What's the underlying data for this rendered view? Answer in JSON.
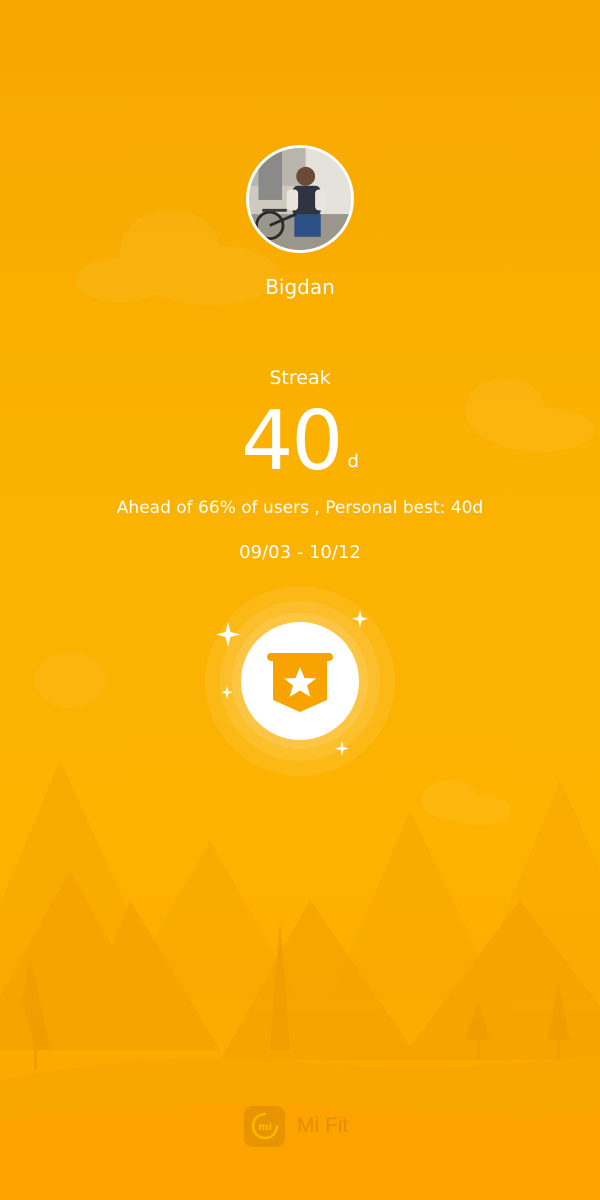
{
  "profile": {
    "username": "Bigdan"
  },
  "streak": {
    "label": "Streak",
    "value": "40",
    "unit": "d",
    "summary": "Ahead of 66% of users , Personal best: 40d",
    "date_range": "09/03 - 10/12"
  },
  "footer": {
    "brand_name": "Mi Fit",
    "logo_text": "mi"
  },
  "icons": {
    "avatar": "avatar-photo",
    "badge": "star-banner-badge-icon",
    "sparkles": "sparkle-icon",
    "logo": "mi-fit-logo-icon"
  },
  "colors": {
    "background_top": "#f6a700",
    "background_bottom": "#fca500",
    "text": "#ffffff",
    "badge_icon": "#f9a300",
    "brand": "#e08e00"
  }
}
